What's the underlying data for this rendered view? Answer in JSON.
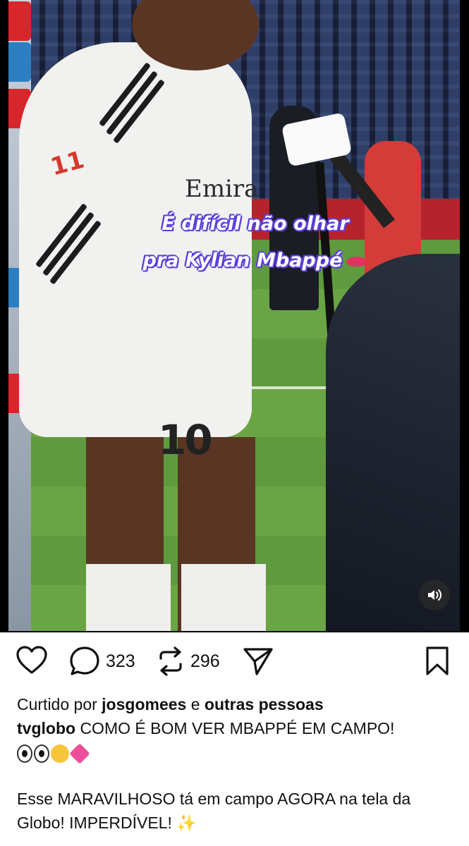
{
  "video": {
    "overlay_caption_line1": "É difícil não olhar",
    "overlay_caption_line2": "pra Kylian Mbappé",
    "overlay_emoji": "lips-emoji",
    "jersey_number": "10",
    "sleeve_number": "11",
    "chest_sponsor": "Emira",
    "sound_button_icon": "speaker-icon"
  },
  "actions": {
    "like_icon": "heart-icon",
    "comment_icon": "comment-bubble-icon",
    "comment_count": "323",
    "repost_icon": "repost-icon",
    "repost_count": "296",
    "share_icon": "send-icon",
    "save_icon": "bookmark-icon"
  },
  "post": {
    "liked_by_prefix": "Curtido por",
    "liked_by_user": "josgomees",
    "liked_by_joiner": "e",
    "liked_by_others": "outras pessoas",
    "author": "tvglobo",
    "caption": "COMO É BOM VER MBAPPÉ EM CAMPO!",
    "caption_emojis": [
      "eyes-emoji",
      "weary-face-emoji",
      "growing-heart-emoji"
    ],
    "body": "Esse MARAVILHOSO tá em campo AGORA na tela da Globo! IMPERDÍVEL!",
    "body_emoji": "✨"
  },
  "colors": {
    "overlay_outline": "#5b3fd9",
    "text": "#111111",
    "background": "#ffffff"
  }
}
